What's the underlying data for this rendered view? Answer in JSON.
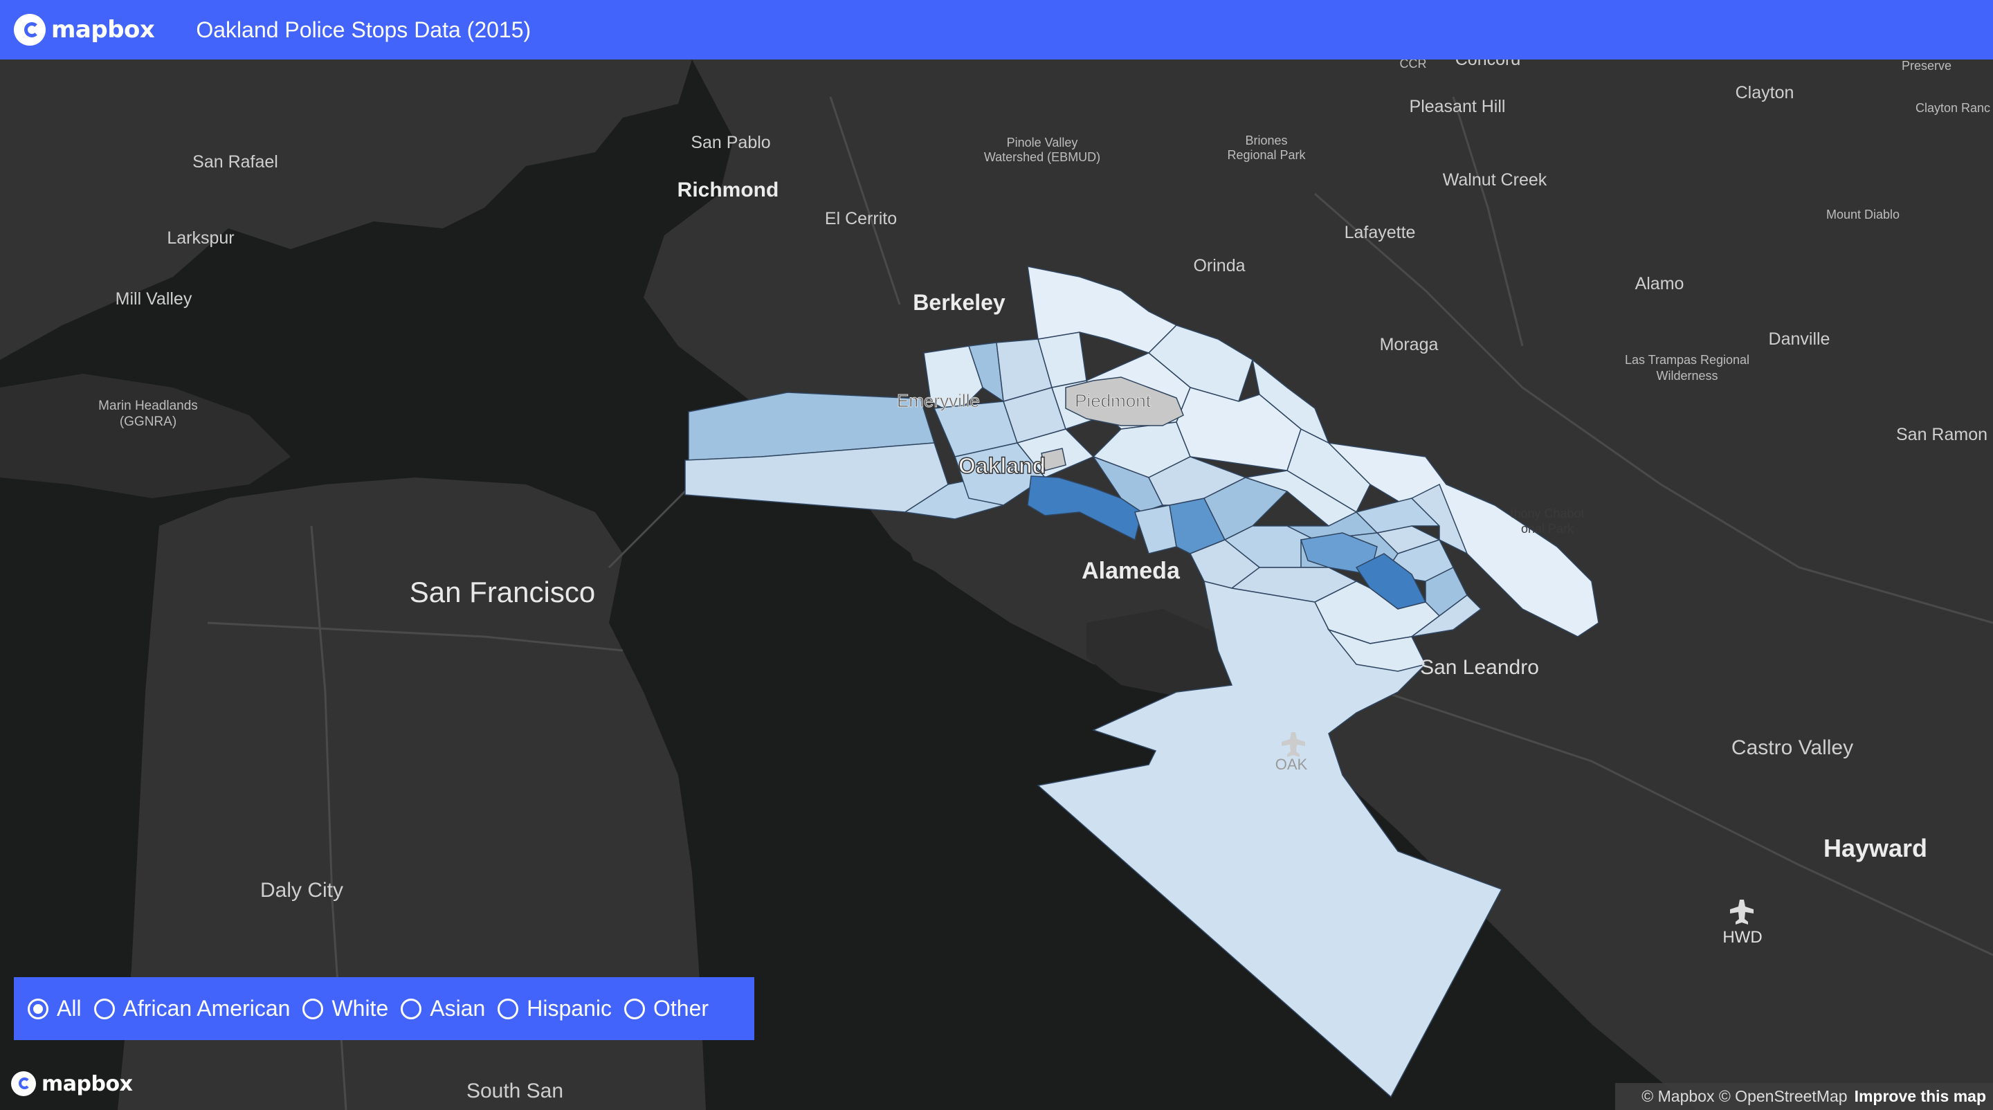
{
  "header": {
    "brand": "mapbox",
    "title": "Oakland Police Stops Data (2015)"
  },
  "filter": {
    "selected": "All",
    "options": [
      "All",
      "African American",
      "White",
      "Asian",
      "Hispanic",
      "Other"
    ]
  },
  "map": {
    "labels": {
      "san_francisco": "San Francisco",
      "alameda": "Alameda",
      "oakland": "Oakland",
      "berkeley": "Berkeley",
      "richmond": "Richmond",
      "hayward": "Hayward",
      "san_leandro": "San Leandro",
      "castro_valley": "Castro Valley",
      "daly_city": "Daly City",
      "south_san": "South San",
      "san_rafael": "San Rafael",
      "larkspur": "Larkspur",
      "mill_valley": "Mill Valley",
      "marin_headlands": "Marin Headlands",
      "ggnra": "(GGNRA)",
      "san_pablo": "San Pablo",
      "el_cerrito": "El Cerrito",
      "emeryville": "Emeryville",
      "piedmont": "Piedmont",
      "pinole_valley": "Pinole Valley",
      "watershed": "Watershed (EBMUD)",
      "briones": "Briones",
      "regional_park": "Regional Park",
      "orinda": "Orinda",
      "lafayette": "Lafayette",
      "moraga": "Moraga",
      "pleasant_hill": "Pleasant Hill",
      "walnut_creek": "Walnut Creek",
      "clayton": "Clayton",
      "clayton_ranch": "Clayton Ranc",
      "preserve": "Preserve",
      "mount_diablo": "Mount Diablo",
      "alamo": "Alamo",
      "danville": "Danville",
      "las_trampas": "Las Trampas Regional",
      "wilderness": "Wilderness",
      "san_ramon": "San Ramon",
      "chabot_1": "thony Chabot",
      "chabot_2": "onal Park",
      "oak": "OAK",
      "hwd": "HWD",
      "ccr": "CCR",
      "concord": "Concord"
    },
    "colors": {
      "water": "#1b1c1c",
      "land": "#333333",
      "choropleth_low": "#dceaf6",
      "choropleth_high": "#3f7ec1",
      "excluded": "#c8c8c8"
    }
  },
  "logo_bottom": "mapbox",
  "attribution": {
    "text": "© Mapbox © OpenStreetMap",
    "improve": "Improve this map"
  }
}
